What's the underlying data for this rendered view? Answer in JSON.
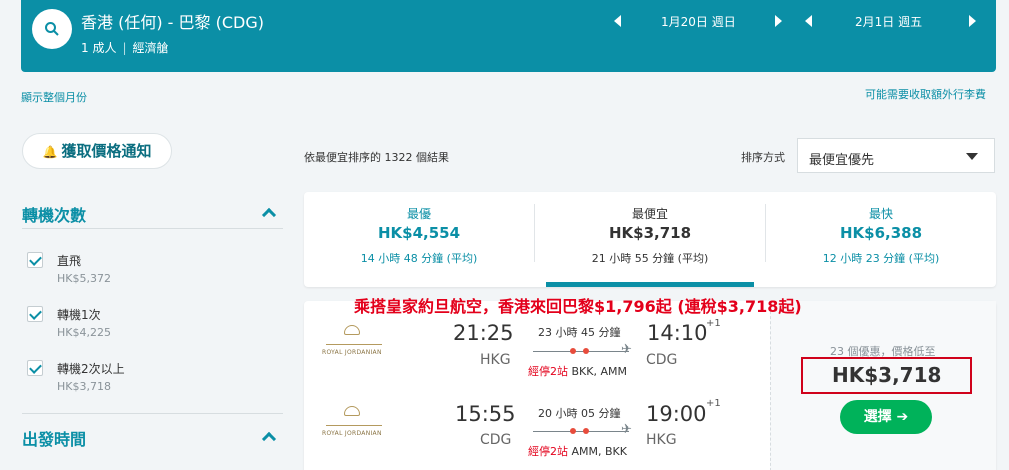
{
  "search": {
    "route": "香港 (任何) - 巴黎 (CDG)",
    "passengers": "1 成人",
    "cabin": "經濟艙",
    "depart_date": "1月20日 週日",
    "return_date": "2月1日 週五"
  },
  "links": {
    "show_month": "顯示整個月份",
    "baggage_fees": "可能需要收取額外行李費"
  },
  "sidebar": {
    "price_alert": "獲取價格通知",
    "stops_title": "轉機次數",
    "stops": [
      {
        "label": "直飛",
        "price": "HK$5,372",
        "checked": true
      },
      {
        "label": "轉機1次",
        "price": "HK$4,225",
        "checked": true
      },
      {
        "label": "轉機2次以上",
        "price": "HK$3,718",
        "checked": true
      }
    ],
    "depart_time_title": "出發時間"
  },
  "results": {
    "count_text": "依最便宜排序的 1322 個結果",
    "sort_label": "排序方式",
    "sort_value": "最便宜優先"
  },
  "tabs": [
    {
      "label": "最優",
      "price": "HK$4,554",
      "duration": "14 小時 48 分鐘 (平均)"
    },
    {
      "label": "最便宜",
      "price": "HK$3,718",
      "duration": "21 小時 55 分鐘 (平均)",
      "active": true
    },
    {
      "label": "最快",
      "price": "HK$6,388",
      "duration": "12 小時 23 分鐘 (平均)"
    }
  ],
  "promo": "乘搭皇家約旦航空，香港來回巴黎$1,796起 (連稅$3,718起)",
  "flight": {
    "airline_logo_text": "ROYAL JORDANIAN",
    "outbound": {
      "dep_time": "21:25",
      "dep_code": "HKG",
      "arr_time": "14:10",
      "arr_plus": "+1",
      "arr_code": "CDG",
      "duration": "23 小時 45 分鐘",
      "stops": "經停2站",
      "via": "BKK, AMM"
    },
    "inbound": {
      "dep_time": "15:55",
      "dep_code": "CDG",
      "arr_time": "19:00",
      "arr_plus": "+1",
      "arr_code": "HKG",
      "duration": "20 小時 05 分鐘",
      "stops": "經停2站",
      "via": "AMM, BKK"
    },
    "deals_text": "23 個優惠，價格低至",
    "price": "HK$3,718",
    "select_label": "選擇 ➔"
  },
  "colors": {
    "brand_teal": "#0b8fa6",
    "promo_red": "#e3001b",
    "select_green": "#00b25a"
  },
  "icons": [
    "search-icon",
    "bell-icon",
    "chevron-up-icon",
    "check-icon",
    "caret-down-icon",
    "arrow-left-icon",
    "arrow-right-icon",
    "plane-icon"
  ]
}
